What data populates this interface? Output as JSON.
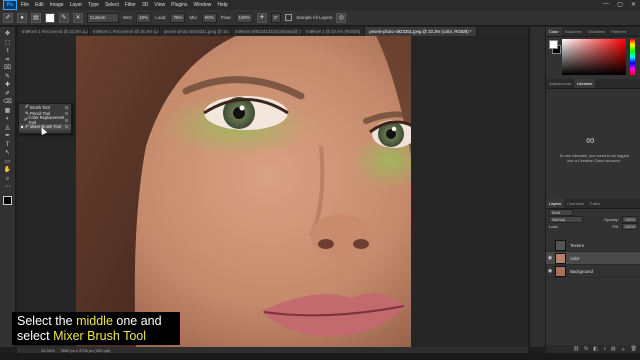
{
  "menubar": {
    "logo": "Ps",
    "items": [
      "File",
      "Edit",
      "Image",
      "Layer",
      "Type",
      "Select",
      "Filter",
      "3D",
      "View",
      "Plugins",
      "Window",
      "Help"
    ],
    "controls": [
      "—",
      "▢",
      "✕"
    ]
  },
  "options": {
    "mode_label": "Custom",
    "wet_label": "Wet:",
    "wet_value": "10%",
    "load_label": "Load:",
    "load_value": "75%",
    "mix_label": "Mix:",
    "mix_value": "90%",
    "flow_label": "Flow:",
    "flow_value": "100%",
    "angle_value": "0°",
    "sample_label": "Sample All Layers"
  },
  "tabs": [
    "tnt9Ke8 1 Recovered @ 33.3% (Layer 1, R…",
    "tnt9Ke8 1 Recovered @ 25.3% (Layer 1, R…",
    "pexels-photo-3918321.jpeg @ 16.7% (RG…",
    "tnt9Ke8 48823312222ce84a6a@ 16.7%…",
    "tnt9Ke8 1 @ 33.4% (RGB/8)",
    "pexels-photo-4923251.jpeg @ 33.3% (color, RGB/8) *"
  ],
  "active_tab": 5,
  "tools": [
    "✥",
    "⬚",
    "ℓ",
    "⌗",
    "⌧",
    "✎",
    "✚",
    "✐",
    "⌫",
    "▦",
    "◐",
    "◬",
    "✒",
    "T",
    "↖",
    "▭",
    "✋",
    "⌕",
    "⋯"
  ],
  "flyout": {
    "items": [
      {
        "bullet": "",
        "icon": "✐",
        "label": "Brush Tool",
        "key": "B"
      },
      {
        "bullet": "",
        "icon": "✎",
        "label": "Pencil Tool",
        "key": "B"
      },
      {
        "bullet": "",
        "icon": "✐",
        "label": "Color Replacement Tool",
        "key": "B"
      },
      {
        "bullet": "■",
        "icon": "✐",
        "label": "Mixer Brush Tool",
        "key": "B"
      }
    ]
  },
  "subtitle": {
    "line1_a": "Select the ",
    "line1_hl": "middle",
    "line1_b": " one and",
    "line2_a": "select ",
    "line2_hl": "Mixer Brush Tool"
  },
  "status": {
    "zoom": "33.33%",
    "doc": "3950 px x 3750 px (300 ppi)"
  },
  "panels": {
    "color_tabs": [
      "Color",
      "Swatches",
      "Gradients",
      "Patterns"
    ],
    "adj_tabs": [
      "Adjustments",
      "Libraries"
    ],
    "cc_text": "To use Libraries, you need to be logged into a Creative Cloud account.",
    "layers_tabs": [
      "Layers",
      "Channels",
      "Paths"
    ],
    "kind_label": "Kind",
    "blend_label": "Normal",
    "opacity_label": "Opacity:",
    "opacity_value": "100%",
    "lock_label": "Lock:",
    "fill_label": "Fill:",
    "fill_value": "100%",
    "layers": [
      {
        "name": "Texture",
        "visible": false,
        "selected": false
      },
      {
        "name": "color",
        "visible": true,
        "selected": true
      },
      {
        "name": "Background",
        "visible": true,
        "selected": false
      }
    ],
    "footer_icons": [
      "⛓",
      "fx",
      "◧",
      "◑",
      "▤",
      "＋",
      "🗑"
    ]
  },
  "colors": {
    "accent": "#31a8ff",
    "highlight": "#f0e64a"
  }
}
